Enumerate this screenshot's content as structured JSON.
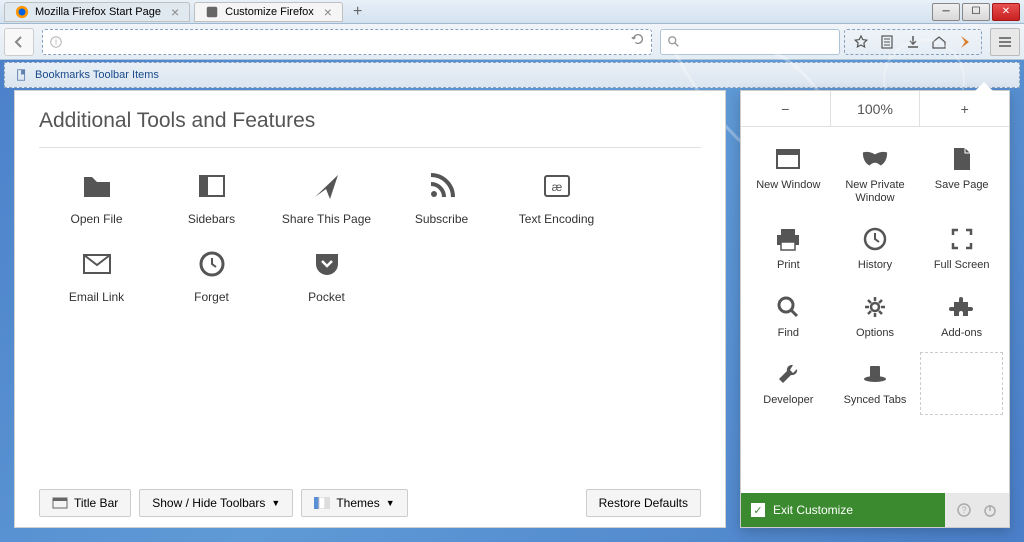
{
  "tabs": [
    {
      "label": "Mozilla Firefox Start Page",
      "favicon": "firefox"
    },
    {
      "label": "Customize Firefox",
      "favicon": "gear"
    }
  ],
  "bookmarks_bar_label": "Bookmarks Toolbar Items",
  "panel_title": "Additional Tools and Features",
  "tools": [
    {
      "label": "Open File",
      "icon": "folder"
    },
    {
      "label": "Sidebars",
      "icon": "sidebar"
    },
    {
      "label": "Share This Page",
      "icon": "share"
    },
    {
      "label": "Subscribe",
      "icon": "rss"
    },
    {
      "label": "Text Encoding",
      "icon": "encoding"
    },
    {
      "label": "Email Link",
      "icon": "mail"
    },
    {
      "label": "Forget",
      "icon": "forget"
    },
    {
      "label": "Pocket",
      "icon": "pocket"
    }
  ],
  "bottom_buttons": {
    "title_bar": "Title Bar",
    "show_hide": "Show / Hide Toolbars",
    "themes": "Themes",
    "restore": "Restore Defaults"
  },
  "zoom": {
    "minus": "−",
    "value": "100%",
    "plus": "+"
  },
  "menu_items": [
    {
      "label": "New Window",
      "icon": "window"
    },
    {
      "label": "New Private Window",
      "icon": "mask"
    },
    {
      "label": "Save Page",
      "icon": "page"
    },
    {
      "label": "Print",
      "icon": "print"
    },
    {
      "label": "History",
      "icon": "clock"
    },
    {
      "label": "Full Screen",
      "icon": "fullscreen"
    },
    {
      "label": "Find",
      "icon": "magnify"
    },
    {
      "label": "Options",
      "icon": "gear"
    },
    {
      "label": "Add-ons",
      "icon": "puzzle"
    },
    {
      "label": "Developer",
      "icon": "wrench"
    },
    {
      "label": "Synced Tabs",
      "icon": "hat"
    },
    {
      "label": "",
      "icon": "",
      "dashed": true
    }
  ],
  "exit_label": "Exit Customize",
  "search_placeholder": ""
}
